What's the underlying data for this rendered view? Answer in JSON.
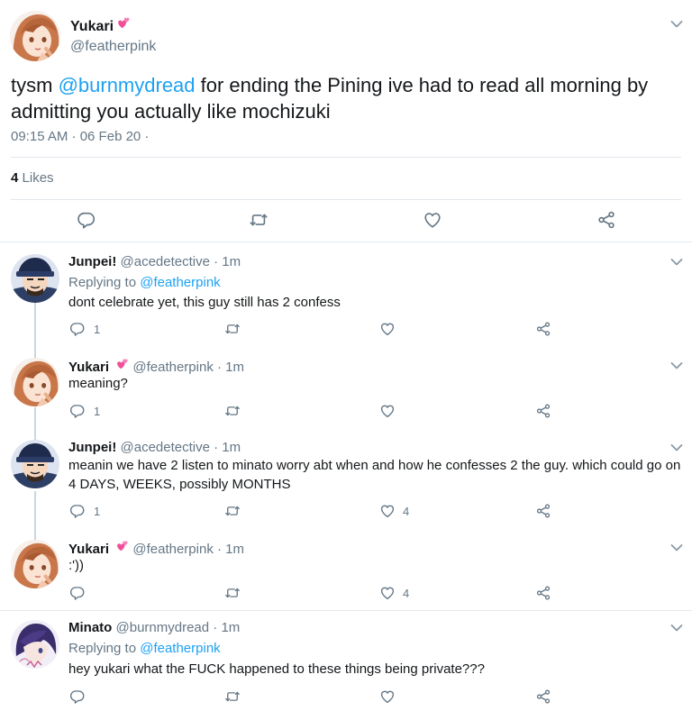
{
  "main_tweet": {
    "name": "Yukari",
    "handle": "@featherpink",
    "text_before": "tysm ",
    "mention": "@burnmydread",
    "text_after": " for ending the Pining ive had to read all morning by admitting you actually like mochizuki",
    "timestamp": "09:15 AM · 06 Feb 20 ·",
    "likes_count": "4",
    "likes_label": "Likes"
  },
  "replies": [
    {
      "name": "Junpei!",
      "handle": "@acedetective · 1m",
      "replying_label": "Replying to",
      "replying_to": "@featherpink",
      "text": "dont celebrate yet, this guy still has 2 confess",
      "reply_count": "1",
      "like_count": ""
    },
    {
      "name": "Yukari",
      "handle": "@featherpink · 1m",
      "text": "meaning?",
      "reply_count": "1",
      "like_count": ""
    },
    {
      "name": "Junpei!",
      "handle": "@acedetective · 1m",
      "text": "meanin we have 2 listen to minato worry abt when and how he confesses 2 the guy. which could go on 4 DAYS, WEEKS, possibly MONTHS",
      "reply_count": "1",
      "like_count": "4"
    },
    {
      "name": "Yukari",
      "handle": "@featherpink · 1m",
      "text": ":'))",
      "reply_count": "",
      "like_count": "4"
    },
    {
      "name": "Minato",
      "handle": "@burnmydread · 1m",
      "replying_label": "Replying to",
      "replying_to": "@featherpink",
      "text": "hey yukari what the FUCK happened to these things being private???",
      "reply_count": "",
      "like_count": ""
    }
  ],
  "colors": {
    "link": "#1da1f2",
    "secondary": "#657786",
    "divider": "#e1e8ed",
    "thread": "#ccd6dd"
  },
  "icons": [
    "reply-icon",
    "retweet-icon",
    "like-icon",
    "share-icon",
    "chevron-down-icon",
    "two-hearts-emoji"
  ]
}
